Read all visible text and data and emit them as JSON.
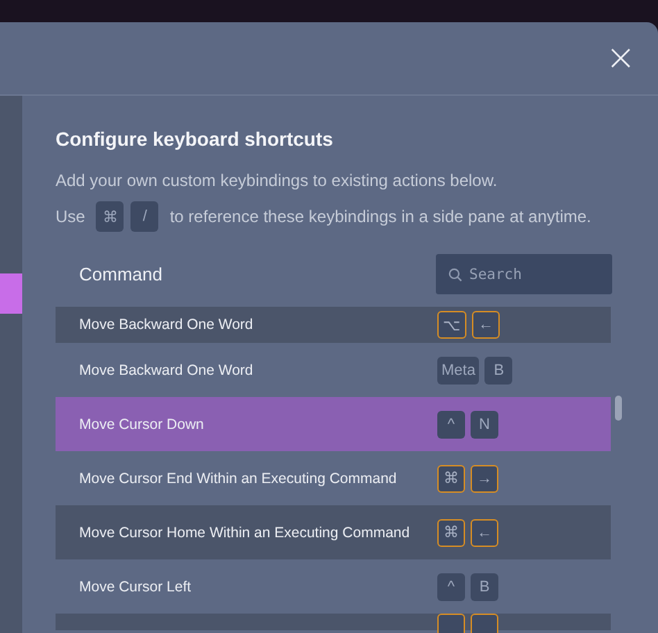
{
  "dialog": {
    "close_label": "×",
    "title": "Configure keyboard shortcuts",
    "description": "Add your own custom keybindings to existing actions below.",
    "hint": {
      "prefix": "Use",
      "keys": [
        "⌘",
        "/"
      ],
      "suffix": "to reference these keybindings in a side pane at anytime."
    }
  },
  "table": {
    "column_header": "Command",
    "search": {
      "placeholder": "Search"
    },
    "rows": [
      {
        "command": "Move Backward One Word",
        "selected": false,
        "keys": [
          {
            "label": "⌥",
            "highlighted": true
          },
          {
            "label": "←",
            "highlighted": true
          }
        ]
      },
      {
        "command": "Move Backward One Word",
        "selected": false,
        "keys": [
          {
            "label": "Meta",
            "highlighted": false
          },
          {
            "label": "B",
            "highlighted": false
          }
        ]
      },
      {
        "command": "Move Cursor Down",
        "selected": true,
        "keys": [
          {
            "label": "^",
            "highlighted": false
          },
          {
            "label": "N",
            "highlighted": false
          }
        ]
      },
      {
        "command": "Move Cursor End Within an Executing Command",
        "selected": false,
        "keys": [
          {
            "label": "⌘",
            "highlighted": true
          },
          {
            "label": "→",
            "highlighted": true
          }
        ]
      },
      {
        "command": "Move Cursor Home Within an Executing Command",
        "selected": false,
        "keys": [
          {
            "label": "⌘",
            "highlighted": true
          },
          {
            "label": "←",
            "highlighted": true
          }
        ]
      },
      {
        "command": "Move Cursor Left",
        "selected": false,
        "keys": [
          {
            "label": "^",
            "highlighted": false
          },
          {
            "label": "B",
            "highlighted": false
          }
        ]
      },
      {
        "selected": false,
        "keys": [
          {
            "highlighted": true
          },
          {
            "highlighted": true
          }
        ]
      }
    ]
  }
}
